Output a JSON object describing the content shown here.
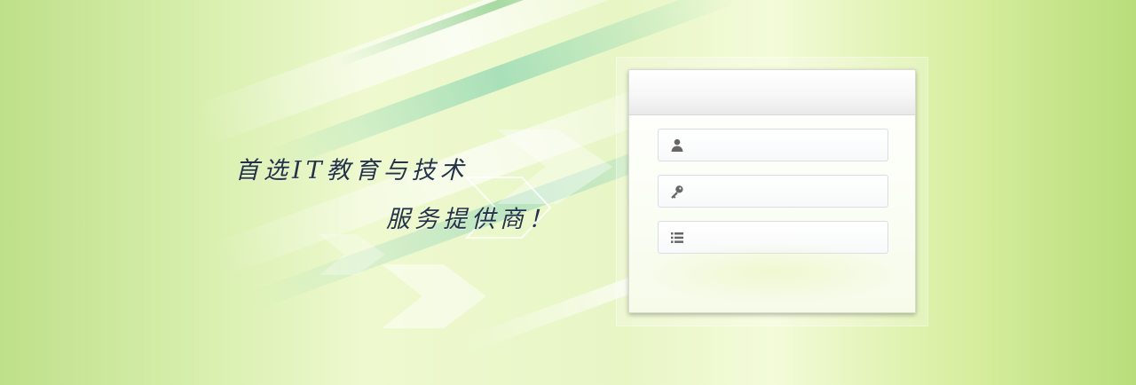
{
  "slogan": {
    "line1": "首选IT教育与技术",
    "line2": "服务提供商！"
  },
  "login": {
    "username_placeholder": "",
    "password_placeholder": "",
    "code_placeholder": "",
    "username_value": "",
    "password_value": "",
    "code_value": ""
  },
  "icons": {
    "username": "user-icon",
    "password": "key-icon",
    "code": "list-icon"
  },
  "colors": {
    "slogan": "#243346",
    "icon": "#666666",
    "panel_header_top": "#ffffff",
    "panel_header_bottom": "#e9e9e9"
  }
}
